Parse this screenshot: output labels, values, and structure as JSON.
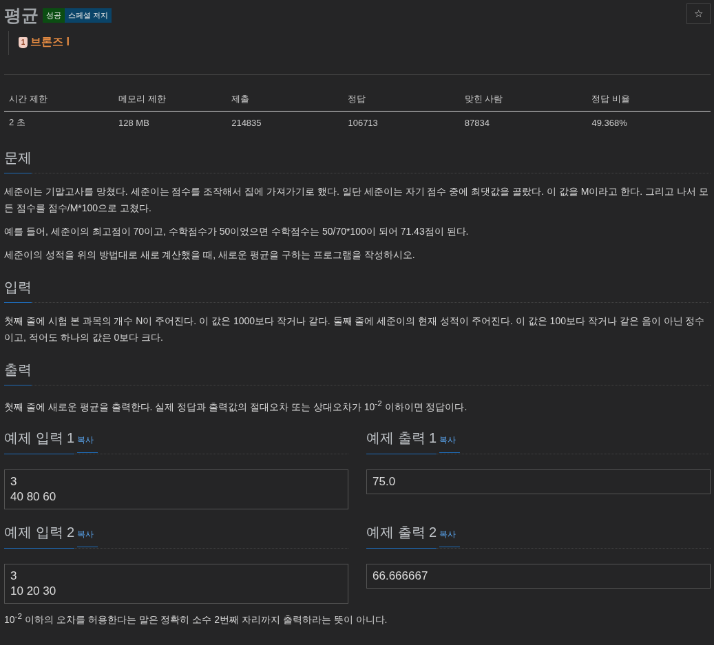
{
  "title": "평균",
  "badges": [
    {
      "label": "성공",
      "color": "#0b4d12"
    },
    {
      "label": "스페셜 저지",
      "color": "#0a4468"
    }
  ],
  "star_button": "☆",
  "tier": {
    "icon_text": "1",
    "label": "브론즈 I"
  },
  "stats": {
    "columns": [
      "시간 제한",
      "메모리 제한",
      "제출",
      "정답",
      "맞힌 사람",
      "정답 비율"
    ],
    "row": [
      "2 초",
      "128 MB",
      "214835",
      "106713",
      "87834",
      "49.368%"
    ]
  },
  "sections": [
    {
      "heading": "문제",
      "paragraphs": [
        "세준이는 기말고사를 망쳤다. 세준이는 점수를 조작해서 집에 가져가기로 했다. 일단 세준이는 자기 점수 중에 최댓값을 골랐다. 이 값을 M이라고 한다. 그리고 나서 모든 점수를 점수/M*100으로 고쳤다.",
        "예를 들어, 세준이의 최고점이 70이고, 수학점수가 50이었으면 수학점수는 50/70*100이 되어 71.43점이 된다.",
        "세준이의 성적을 위의 방법대로 새로 계산했을 때, 새로운 평균을 구하는 프로그램을 작성하시오."
      ]
    },
    {
      "heading": "입력",
      "paragraphs": [
        "첫째 줄에 시험 본 과목의 개수 N이 주어진다. 이 값은 1000보다 작거나 같다. 둘째 줄에 세준이의 현재 성적이 주어진다. 이 값은 100보다 작거나 같은 음이 아닌 정수이고, 적어도 하나의 값은 0보다 크다."
      ]
    },
    {
      "heading": "출력",
      "paragraphs": [
        "첫째 줄에 새로운 평균을 출력한다. 실제 정답과 출력값의 절대오차 또는 상대오차가 10$^{-2}$ 이하이면 정답이다."
      ]
    }
  ],
  "examples": [
    {
      "input_title": "예제 입력 1",
      "input_copy": "복사",
      "input": [
        "3",
        "40 80 60"
      ],
      "output_title": "예제 출력 1",
      "output_copy": "복사",
      "output": [
        "75.0"
      ]
    },
    {
      "input_title": "예제 입력 2",
      "input_copy": "복사",
      "input": [
        "3",
        "10 20 30"
      ],
      "output_title": "예제 출력 2",
      "output_copy": "복사",
      "output": [
        "66.666667"
      ],
      "note": "10$^{-2}$ 이하의 오차를 허용한다는 말은 정확히 소수 2번째 자리까지 출력하라는 뜻이 아니다."
    }
  ]
}
